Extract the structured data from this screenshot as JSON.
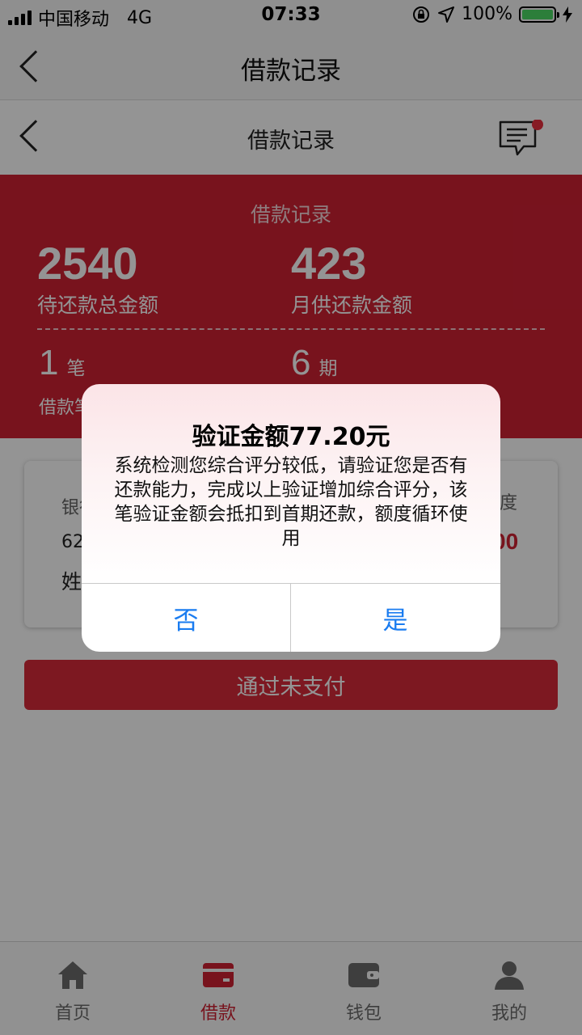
{
  "status_bar": {
    "carrier": "中国移动",
    "network": "4G",
    "time": "07:33",
    "battery": "100%"
  },
  "outer_nav": {
    "title": "借款记录"
  },
  "inner_nav": {
    "title": "借款记录"
  },
  "summary": {
    "title": "借款记录",
    "total_due": {
      "value": "2540",
      "label": "待还款总金额"
    },
    "monthly_due": {
      "value": "423",
      "label": "月供还款金额"
    },
    "count": {
      "value": "1",
      "unit": "笔",
      "label": "借款笔数"
    },
    "periods": {
      "value": "6",
      "unit": "期"
    }
  },
  "card": {
    "bank_label": "银行",
    "card_number": "62",
    "name_label": "姓",
    "limit_label": "度",
    "amount": "00"
  },
  "pay_button": {
    "label": "通过未支付"
  },
  "tabs": [
    {
      "label": "首页",
      "icon": "home-icon"
    },
    {
      "label": "借款",
      "icon": "card-icon"
    },
    {
      "label": "钱包",
      "icon": "wallet-icon"
    },
    {
      "label": "我的",
      "icon": "user-icon"
    }
  ],
  "alert": {
    "title": "验证金额77.20元",
    "message": "系统检测您综合评分较低，请验证您是否有还款能力，完成以上验证增加综合评分，该笔验证金额会抵扣到首期还款，额度循环使用",
    "cancel_label": "否",
    "confirm_label": "是"
  },
  "colors": {
    "primary_red": "#cf2133",
    "ios_blue": "#1a7cf0",
    "tab_inactive": "#6b6b6b"
  }
}
